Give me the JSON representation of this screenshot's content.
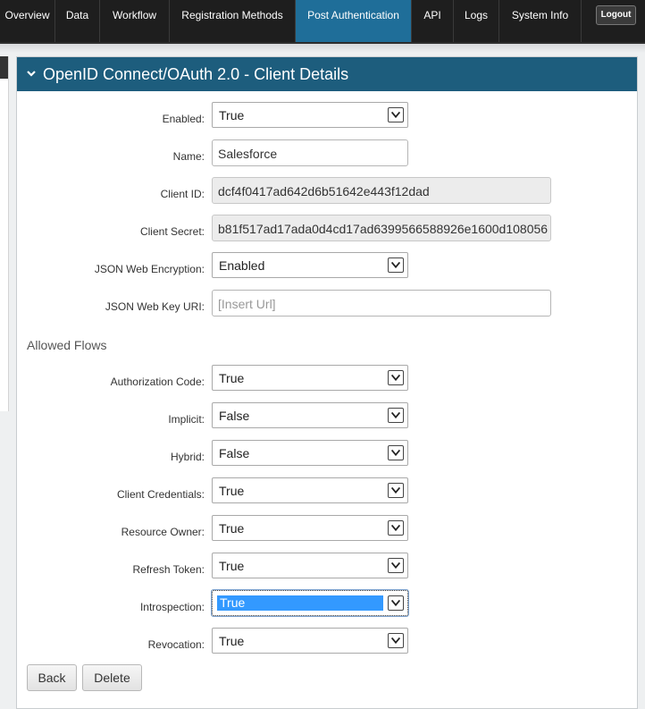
{
  "nav": {
    "tabs": [
      {
        "label": "Overview"
      },
      {
        "label": "Data"
      },
      {
        "label": "Workflow"
      },
      {
        "label": "Registration Methods"
      },
      {
        "label": "Post Authentication"
      },
      {
        "label": "API"
      },
      {
        "label": "Logs"
      },
      {
        "label": "System Info"
      }
    ],
    "active_tab": "Post Authentication",
    "logout_label": "Logout"
  },
  "panel": {
    "title": "OpenID Connect/OAuth 2.0 - Client Details"
  },
  "form": {
    "enabled": {
      "label": "Enabled:",
      "value": "True"
    },
    "name": {
      "label": "Name:",
      "value": "Salesforce"
    },
    "client_id": {
      "label": "Client ID:",
      "value": "dcf4f0417ad642d6b51642e443f12dad"
    },
    "client_secret": {
      "label": "Client Secret:",
      "value": "b81f517ad17ada0d4cd17ad6399566588926e1600d108056"
    },
    "jwe": {
      "label": "JSON Web Encryption:",
      "value": "Enabled"
    },
    "jwk_uri": {
      "label": "JSON Web Key URI:",
      "placeholder": "[Insert Url]"
    }
  },
  "allowed_flows": {
    "heading": "Allowed Flows",
    "authorization_code": {
      "label": "Authorization Code:",
      "value": "True"
    },
    "implicit": {
      "label": "Implicit:",
      "value": "False"
    },
    "hybrid": {
      "label": "Hybrid:",
      "value": "False"
    },
    "client_credentials": {
      "label": "Client Credentials:",
      "value": "True"
    },
    "resource_owner": {
      "label": "Resource Owner:",
      "value": "True"
    },
    "refresh_token": {
      "label": "Refresh Token:",
      "value": "True"
    },
    "introspection": {
      "label": "Introspection:",
      "value": "True"
    },
    "revocation": {
      "label": "Revocation:",
      "value": "True"
    }
  },
  "actions": {
    "back_label": "Back",
    "delete_label": "Delete"
  },
  "colors": {
    "header_blue": "#1d5d7d",
    "active_tab": "#1f6e99",
    "selection": "#3399ff"
  }
}
